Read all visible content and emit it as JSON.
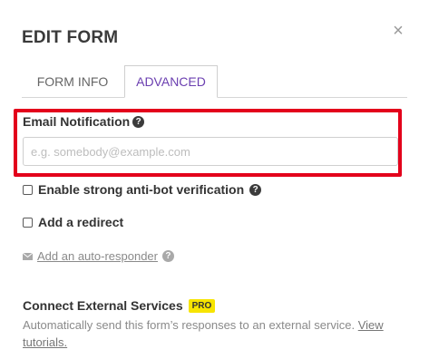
{
  "dialog": {
    "title": "EDIT FORM",
    "close_symbol": "×"
  },
  "tabs": [
    {
      "label": "FORM INFO",
      "active": false
    },
    {
      "label": "ADVANCED",
      "active": true
    }
  ],
  "email_notification": {
    "label": "Email Notification",
    "help_icon": "question-circle-icon",
    "value": "",
    "placeholder": "e.g. somebody@example.com"
  },
  "options": {
    "antibot_label": "Enable strong anti-bot verification",
    "antibot_checked": false,
    "redirect_label": "Add a redirect",
    "redirect_checked": false
  },
  "autoresponder": {
    "icon": "envelope-icon",
    "link_text": "Add an auto-responder"
  },
  "external": {
    "title": "Connect External Services",
    "badge": "PRO",
    "description": "Automatically send this form’s responses to an external service.",
    "link_text": "View tutorials."
  },
  "colors": {
    "accent": "#6b3fb0",
    "highlight": "#e3001b",
    "pro_badge": "#f7e400"
  }
}
